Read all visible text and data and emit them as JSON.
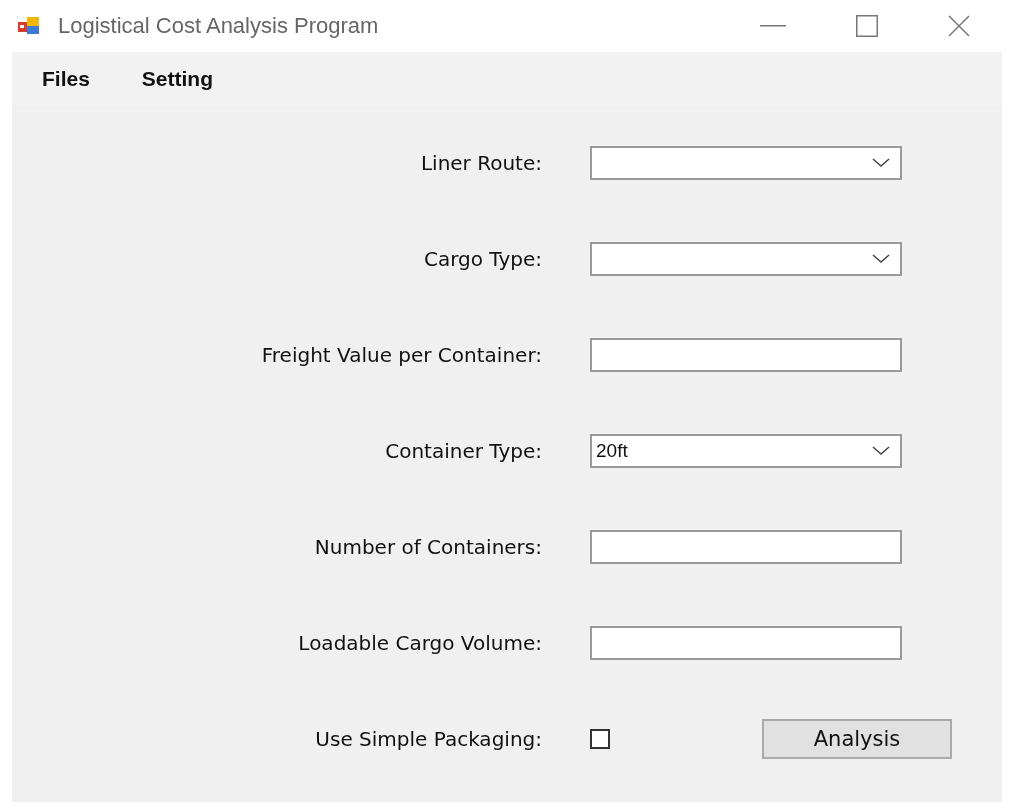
{
  "window": {
    "title": "Logistical Cost Analysis Program"
  },
  "menu": [
    {
      "label": "Files"
    },
    {
      "label": "Setting"
    }
  ],
  "fields": [
    {
      "kind": "dropdown",
      "label": "Liner Route:"
    },
    {
      "kind": "dropdown",
      "label": "Cargo Type:"
    },
    {
      "kind": "text",
      "label": "Freight Value per Container:"
    },
    {
      "kind": "dropdown",
      "label": "Container Type:",
      "value": "20ft"
    },
    {
      "kind": "text",
      "label": "Number of Containers:"
    },
    {
      "kind": "text",
      "label": "Loadable Cargo Volume:"
    },
    {
      "kind": "checkbox",
      "label": "Use Simple Packaging:",
      "checked": false
    }
  ],
  "buttons": [
    {
      "label": "Analysis"
    }
  ]
}
